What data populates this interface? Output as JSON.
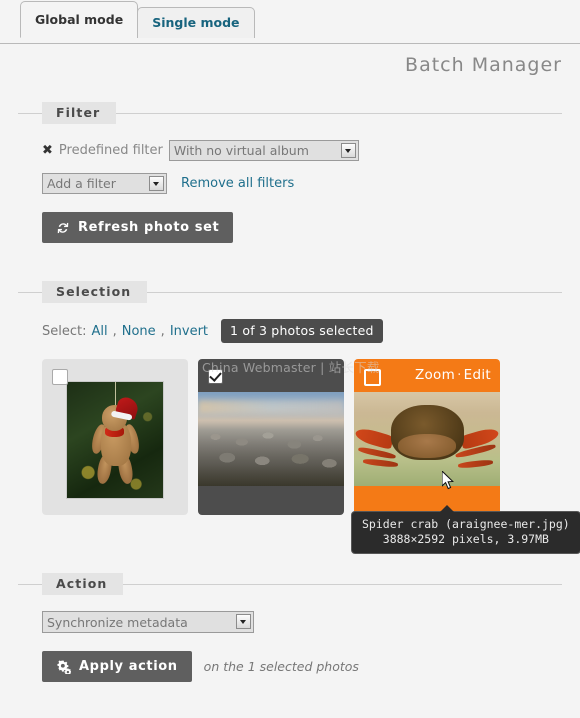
{
  "tabs": [
    {
      "label": "Global mode",
      "active": true
    },
    {
      "label": "Single mode",
      "active": false
    }
  ],
  "header": {
    "title": "Batch Manager"
  },
  "filter": {
    "legend": "Filter",
    "remove_icon": "x-remove-icon",
    "predefined_label": "Predefined filter",
    "predefined_value": "With no virtual album",
    "add_filter_value": "Add a filter",
    "remove_all_link": "Remove all filters",
    "refresh_button": "Refresh photo set",
    "refresh_icon": "refresh-icon"
  },
  "selection": {
    "legend": "Selection",
    "select_label": "Select:",
    "all": "All",
    "none": "None",
    "invert": "Invert",
    "comma": ",",
    "count_badge": "1 of 3 photos selected",
    "watermark": "China Webmaster | 站长下载",
    "thumbnails": [
      {
        "state": "unselected",
        "checked": false,
        "alt": "teddy-bear-christmas"
      },
      {
        "state": "selected",
        "checked": true,
        "alt": "rocky-shore-cairns"
      },
      {
        "state": "hover",
        "checked": false,
        "alt": "spider-crab",
        "zoom_link": "Zoom",
        "separator": "·",
        "edit_link": "Edit"
      }
    ],
    "tooltip": {
      "title": "Spider crab (araignee-mer.jpg)",
      "details": "3888×2592 pixels, 3.97MB"
    }
  },
  "action": {
    "legend": "Action",
    "selected_action": "Synchronize metadata",
    "apply_button": "Apply action",
    "apply_icon": "gears-icon",
    "apply_note": "on the 1 selected photos"
  },
  "colors": {
    "accent_orange": "#f47a16",
    "link_blue": "#1f6f8c",
    "button_gray": "#5f5f5f",
    "selected_gray": "#4d4d4d",
    "page_bg": "#f4f4f4"
  }
}
